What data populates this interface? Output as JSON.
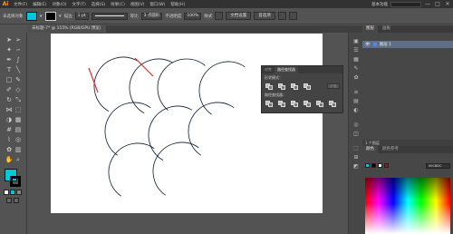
{
  "app": {
    "logo": "Ai"
  },
  "menubar": {
    "items": [
      "文件(F)",
      "编辑(E)",
      "对象(O)",
      "文字(T)",
      "选择(S)",
      "效果(C)",
      "视图(V)",
      "窗口(W)",
      "帮助(H)"
    ],
    "workspace": "基本功能",
    "window_buttons": [
      "—",
      "□",
      "✕"
    ]
  },
  "controlbar": {
    "selection_label": "未选择对象",
    "fill_color": "#00c8dc",
    "stroke_color": "#000000",
    "stroke_label": "描边",
    "stroke_weight": "1 pt",
    "uniform_label": "等比",
    "brush_label": "3 点圆形",
    "opacity_label": "不透明度",
    "opacity_value": "100%",
    "style_label": "样式",
    "doc_setup_button": "文档设置",
    "prefs_button": "首选项"
  },
  "document": {
    "tab_label": "未标题-7* @ 115% (RGB/GPU 预览)",
    "zoom": "115%"
  },
  "artwork": {
    "shape_fill": "#1ec8e0",
    "shape_stroke": "#0a1a2a",
    "pen_color": "#e03030"
  },
  "pathfinder": {
    "tabs": [
      "对齐",
      "路径查找器"
    ],
    "shape_modes_label": "形状模式：",
    "pathfinders_label": "路径查找器：",
    "expand_button": "扩展"
  },
  "right_panels": {
    "layers_tabs": [
      "图层",
      "画板"
    ],
    "layer_name": "图层 1",
    "layers_footer": "1 个图层",
    "color_tabs": [
      "颜色",
      "颜色参考"
    ],
    "hex_value": "00C8DC"
  },
  "colors": {
    "accent_cyan": "#00c8dc",
    "ui_dark": "#323232",
    "ui_mid": "#535353"
  }
}
